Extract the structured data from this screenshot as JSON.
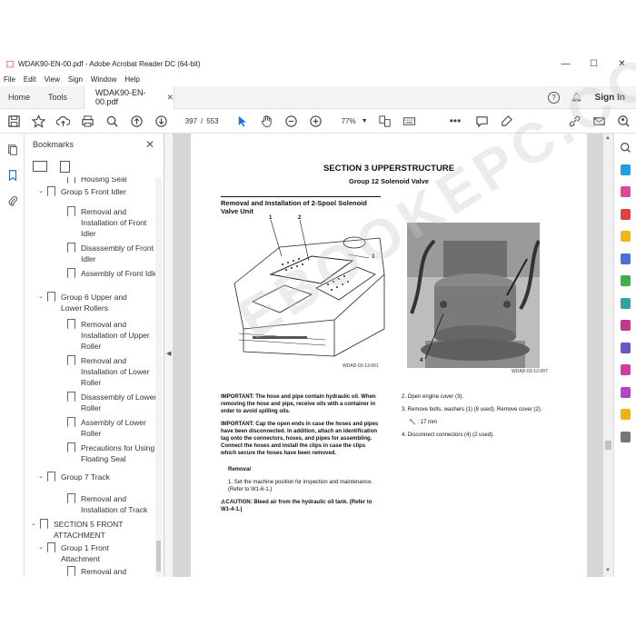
{
  "window": {
    "title": "WDAK90-EN-00.pdf - Adobe Acrobat Reader DC (64-bit)",
    "controls": [
      "—",
      "☐",
      "✕"
    ]
  },
  "menu": [
    "File",
    "Edit",
    "View",
    "Sign",
    "Window",
    "Help"
  ],
  "tabs": {
    "home": "Home",
    "tools": "Tools",
    "document": "WDAK90-EN-00.pdf",
    "sign_in": "Sign In"
  },
  "toolbar": {
    "page_current": "397",
    "page_total": "553",
    "zoom": "77%"
  },
  "bookmarks": {
    "title": "Bookmarks",
    "items": [
      {
        "label": "Housing Seal",
        "level": 2,
        "toggle": ""
      },
      {
        "label": "Group 5 Front Idler",
        "level": 1,
        "toggle": "v"
      },
      {
        "label": "Removal and Installation of Front Idler",
        "level": 2,
        "toggle": ""
      },
      {
        "label": "Disassembly of Front Idler",
        "level": 2,
        "toggle": ""
      },
      {
        "label": "Assembly of Front Idler",
        "level": 2,
        "toggle": ""
      },
      {
        "label": "Group 6 Upper and Lower Rollers",
        "level": 1,
        "toggle": "v"
      },
      {
        "label": "Removal and Installation of Upper Roller",
        "level": 2,
        "toggle": ""
      },
      {
        "label": "Removal and Installation of Lower Roller",
        "level": 2,
        "toggle": ""
      },
      {
        "label": "Disassembly of Lower Roller",
        "level": 2,
        "toggle": ""
      },
      {
        "label": "Assembly of Lower Roller",
        "level": 2,
        "toggle": ""
      },
      {
        "label": "Precautions for Using Floating Seal",
        "level": 2,
        "toggle": ""
      },
      {
        "label": "Group 7 Track",
        "level": 1,
        "toggle": "v"
      },
      {
        "label": "Removal and Installation of Track",
        "level": 2,
        "toggle": ""
      },
      {
        "label": "SECTION 5 FRONT ATTACHMENT",
        "level": 0,
        "toggle": "v"
      },
      {
        "label": "Group 1 Front Attachment",
        "level": 1,
        "toggle": "v"
      },
      {
        "label": "Removal and",
        "level": 2,
        "toggle": ""
      }
    ]
  },
  "document": {
    "section_title": "SECTION 3 UPPERSTRUCTURE",
    "group_title": "Group 12 Solenoid Valve",
    "sub_heading": "Removal and Installation of 2-Spool Solenoid Valve Unit",
    "fig1_caption": "WDAD-03-13-001",
    "fig2_caption": "WDAD-03-12-007",
    "callouts": [
      "1",
      "2",
      "3",
      "4"
    ],
    "important1_label": "IMPORTANT:",
    "important1": "The hose and pipe contain hydraulic oil. When removing the hose and pipe, receive oils with a container in order to avoid spilling oils.",
    "important2_label": "IMPORTANT:",
    "important2": "Cap the open ends in case the hoses and pipes have been disconnected. In addition, attach an identification tag onto the connectors, hoses, and pipes for assembling. Connect the hoses and install the clips in case the clips which secure the hoses have been removed.",
    "removal_heading": "Removal",
    "step1": "1.  Set the machine position for inspection and maintenance. (Refer to W1-6-1.)",
    "caution_label": "CAUTION:",
    "caution": "Bleed air from the hydraulic oil tank. (Refer to W1-4-1.)",
    "step2": "2.  Open engine cover (3).",
    "step3": "3.  Remove bolts, washers (1) (8 used). Remove cover (2).",
    "wrench": ": 17 mm",
    "step4": "4.  Disconnect connectors (4) (2 used).",
    "watermark": "EBOOKEPC.COM"
  }
}
